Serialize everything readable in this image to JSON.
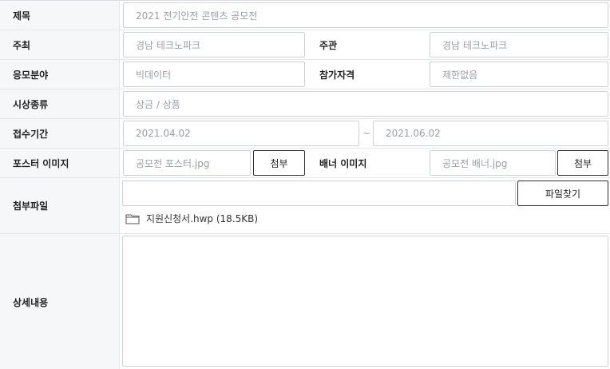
{
  "rows": {
    "title": {
      "label": "제목",
      "value": "2021 전기안전 콘텐츠 공모전"
    },
    "host": {
      "label": "주최",
      "value": "경남 테크노파크"
    },
    "organizer": {
      "label": "주관",
      "value": "경남 테크노파크"
    },
    "field": {
      "label": "응모분야",
      "value": "빅데이터"
    },
    "eligibility": {
      "label": "참가자격",
      "value": "제한없음"
    },
    "award": {
      "label": "시상종류",
      "value": "상금 / 상품"
    },
    "period": {
      "label": "접수기간",
      "start": "2021.04.02",
      "separator": "~",
      "end": "2021.06.02"
    },
    "poster": {
      "label": "포스터 이미지",
      "value": "공모전 포스터.jpg",
      "button": "첨부"
    },
    "banner": {
      "label": "배너 이미지",
      "value": "공모전 배너.jpg",
      "button": "첨부"
    },
    "attachment": {
      "label": "첨부파일",
      "value": "",
      "button": "파일찾기",
      "file": "지원신청서.hwp (18.5KB)",
      "file_icon": "folder-icon"
    },
    "detail": {
      "label": "상세내용",
      "value": ""
    }
  }
}
